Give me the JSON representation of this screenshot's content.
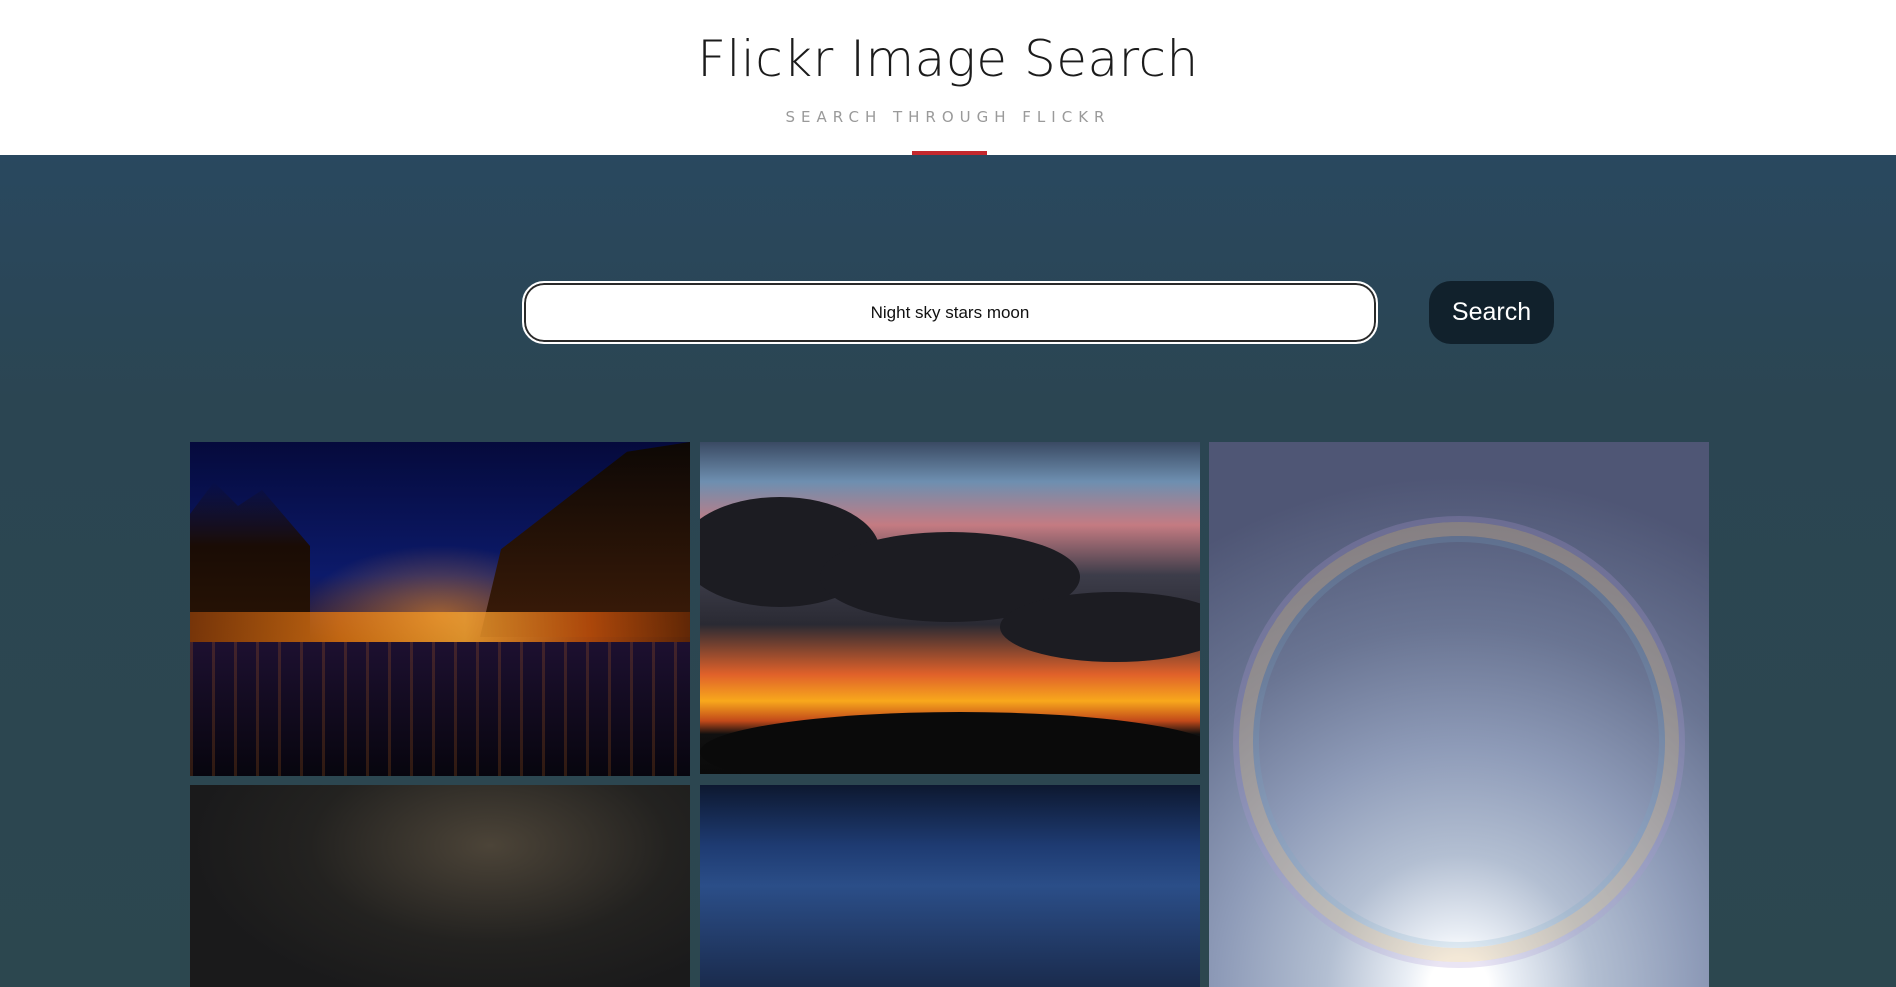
{
  "header": {
    "title": "Flickr Image Search",
    "subtitle": "SEARCH THROUGH FLICKR",
    "accent_color": "#c4282e"
  },
  "search": {
    "value": "Night sky stars moon",
    "button_label": "Search"
  },
  "results": [
    {
      "alt": "marina at night with lit trees",
      "colors": [
        "#0c1a6a",
        "#f6a430"
      ]
    },
    {
      "alt": "sunset clouds over tree silhouettes",
      "colors": [
        "#c47b82",
        "#f8a81c"
      ]
    },
    {
      "alt": "sun halo in cloudy sky",
      "colors": [
        "#8e9bb8",
        "#ffffff"
      ]
    },
    {
      "alt": "milky way star field",
      "colors": [
        "#4c4438"
      ]
    },
    {
      "alt": "dark blue night sky with clouds",
      "colors": [
        "#1e3b72"
      ]
    }
  ]
}
